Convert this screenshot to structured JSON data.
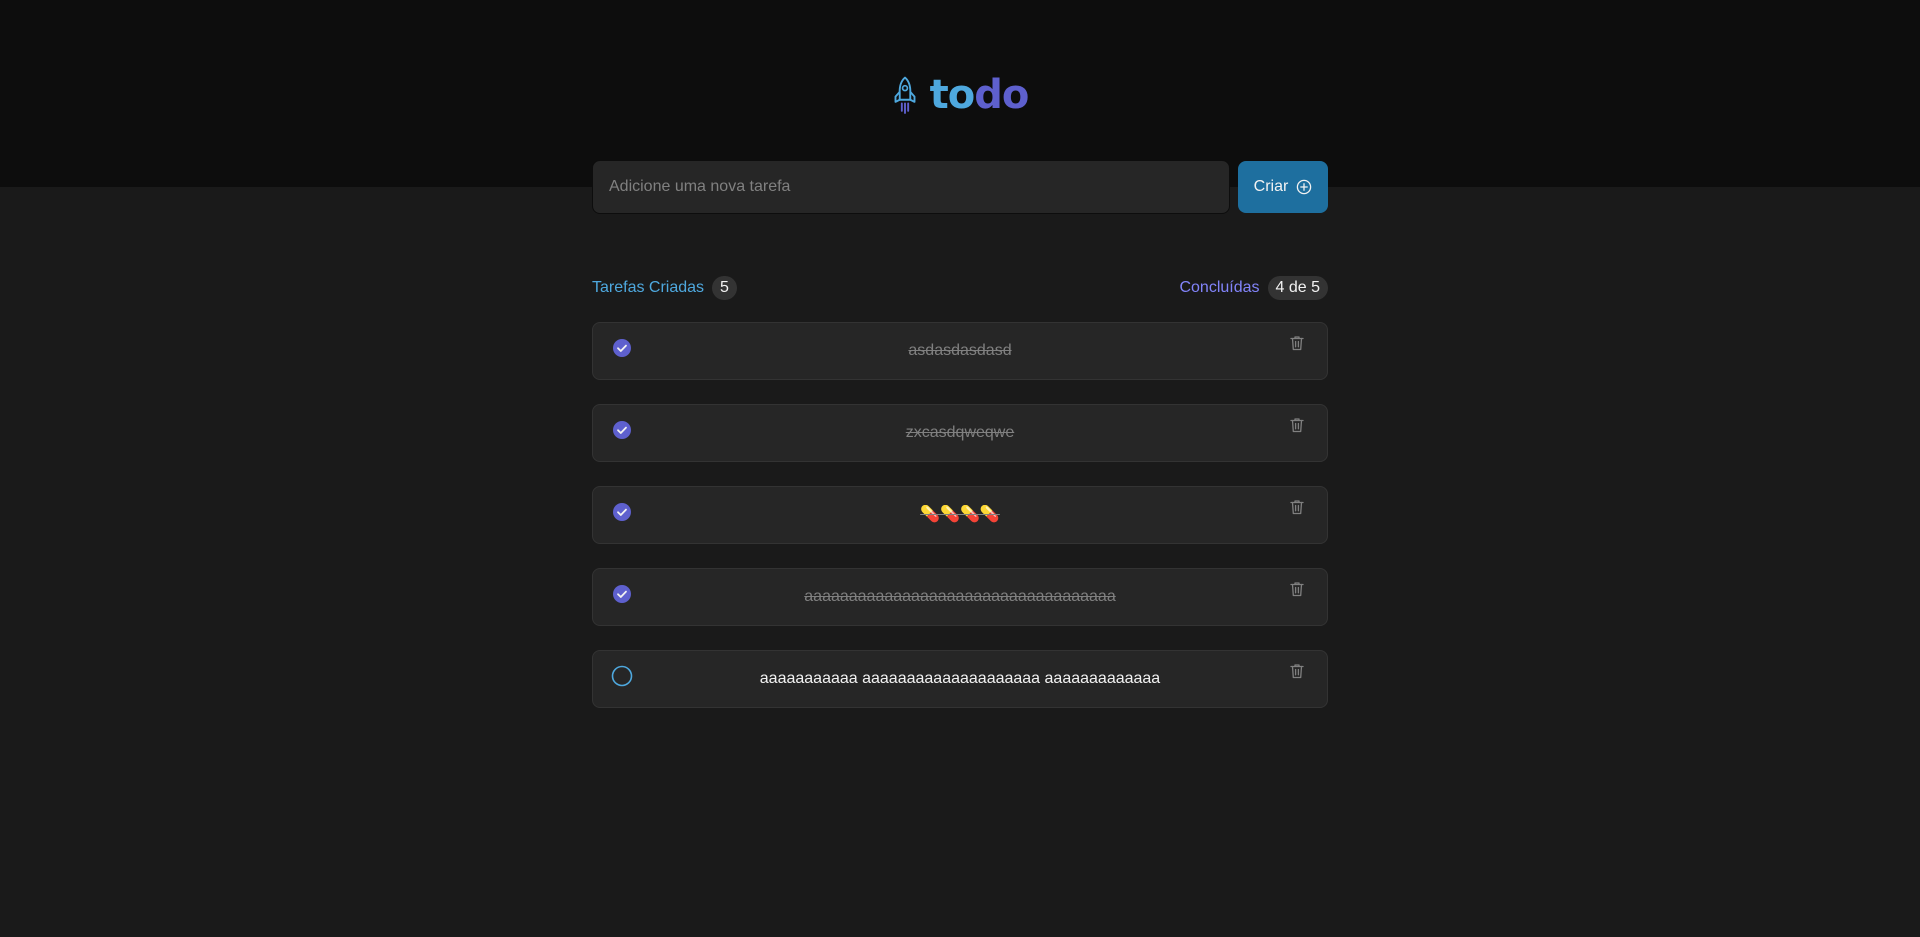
{
  "app": {
    "logo_part1": "to",
    "logo_part2": "do"
  },
  "form": {
    "placeholder": "Adicione uma nova tarefa",
    "value": "",
    "create_label": "Criar"
  },
  "counters": {
    "created_label": "Tarefas Criadas",
    "created_count": "5",
    "done_label": "Concluídas",
    "done_count": "4 de 5"
  },
  "tasks": [
    {
      "text": "asdasdasdasd",
      "done": true
    },
    {
      "text": "zxcasdqweqwe",
      "done": true
    },
    {
      "text": "💊💊💊💊",
      "done": true
    },
    {
      "text": "aaaaaaaaaaaaaaaaaaaaaaaaaaaaaaaaaaa",
      "done": true
    },
    {
      "text": "aaaaaaaaaaa aaaaaaaaaaaaaaaaaaaa aaaaaaaaaaaaa",
      "done": false
    }
  ],
  "icons": {
    "logo": "rocket-icon",
    "create": "plus-circle-icon",
    "checked": "check-circle-icon",
    "unchecked": "empty-circle-icon",
    "delete": "trash-icon"
  },
  "colors": {
    "blue": "#4ea8de",
    "blue_dark": "#1e6f9f",
    "purple": "#5e60ce",
    "purple_light": "#8284fa",
    "header_bg": "#0d0d0d",
    "body_bg": "#1a1a1a",
    "card_bg": "#262626"
  }
}
